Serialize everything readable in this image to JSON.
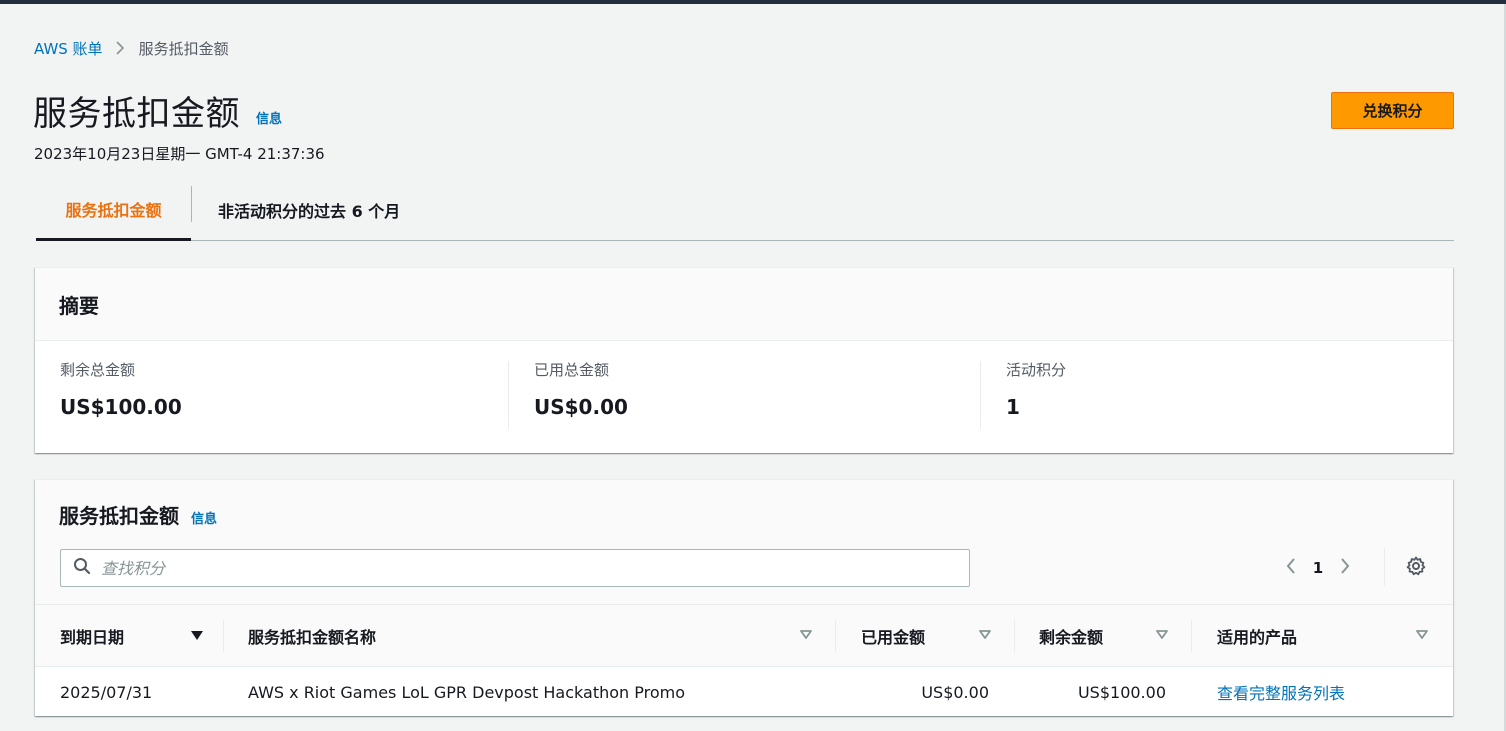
{
  "breadcrumb": {
    "root": "AWS 账单",
    "current": "服务抵扣金额"
  },
  "header": {
    "title": "服务抵扣金额",
    "info": "信息",
    "timestamp": "2023年10月23日星期一 GMT-4 21:37:36",
    "primary_action": "兑换积分"
  },
  "tabs": [
    {
      "label": "服务抵扣金额",
      "active": true
    },
    {
      "label": "非活动积分的过去 6 个月",
      "active": false
    }
  ],
  "summary": {
    "title": "摘要",
    "items": [
      {
        "label": "剩余总金额",
        "value": "US$100.00"
      },
      {
        "label": "已用总金额",
        "value": "US$0.00"
      },
      {
        "label": "活动积分",
        "value": "1"
      }
    ]
  },
  "credits_table": {
    "title": "服务抵扣金额",
    "info": "信息",
    "search_placeholder": "查找积分",
    "page": "1",
    "columns": [
      "到期日期",
      "服务抵扣金额名称",
      "已用金额",
      "剩余金额",
      "适用的产品"
    ],
    "rows": [
      {
        "expiry": "2025/07/31",
        "name": "AWS x Riot Games LoL GPR Devpost Hackathon Promo",
        "used": "US$0.00",
        "remaining": "US$100.00",
        "products_link": "查看完整服务列表"
      }
    ]
  },
  "colors": {
    "link": "#0073bb",
    "accent": "#ff9900",
    "active_tab": "#ec7211"
  }
}
